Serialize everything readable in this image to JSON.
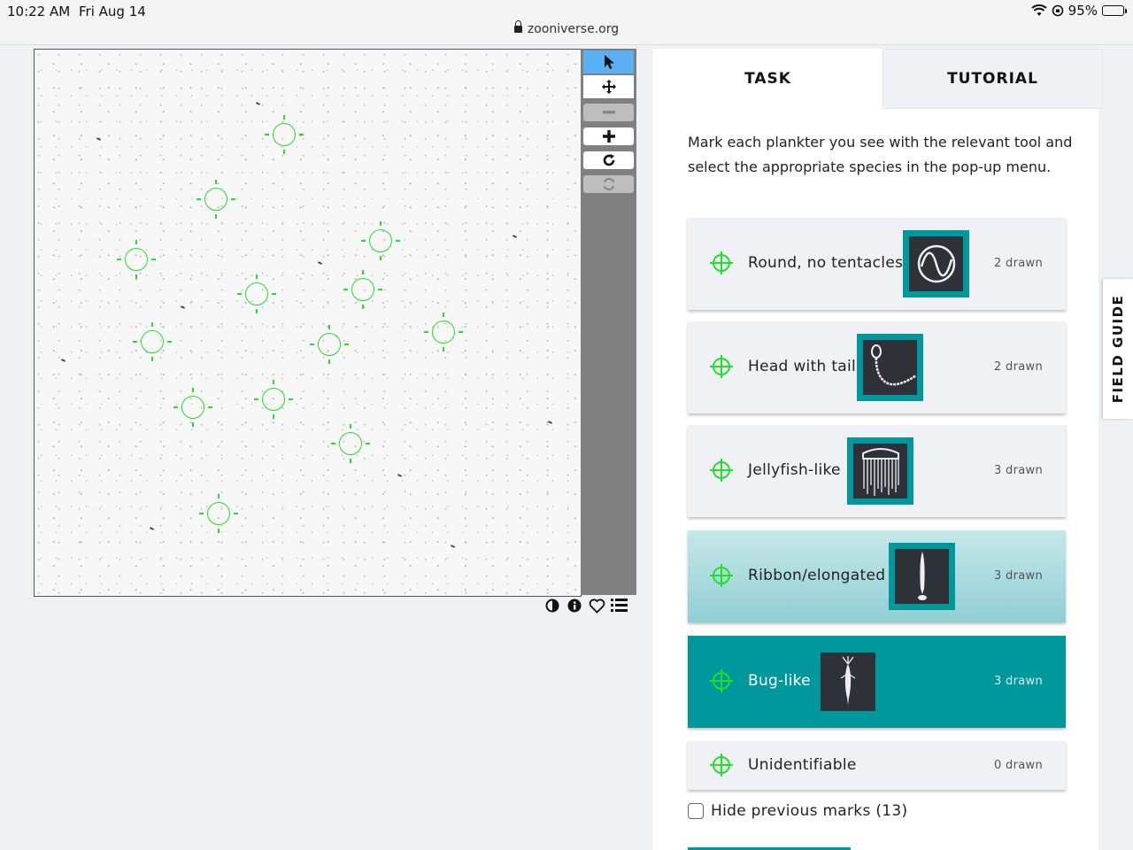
{
  "status_bar": {
    "time": "10:22 AM",
    "date": "Fri Aug 14",
    "url": "zooniverse.org",
    "battery": "95%",
    "battery_level": 0.95
  },
  "toolbar": {
    "tools": [
      {
        "name": "pointer",
        "glyph": "➤",
        "active": true
      },
      {
        "name": "pan",
        "glyph": "✥",
        "active": false
      },
      {
        "name": "zoom-out",
        "glyph": "−",
        "disabled": true
      },
      {
        "name": "zoom-in",
        "glyph": "+"
      },
      {
        "name": "rotate",
        "glyph": "↻"
      },
      {
        "name": "reset",
        "glyph": "⟲",
        "disabled": true
      }
    ],
    "below_icons": [
      "contrast-icon",
      "info-icon",
      "heart-icon",
      "list-icon"
    ]
  },
  "subject": {
    "mark_count": 13
  },
  "tabs": {
    "task": "TASK",
    "tutorial": "TUTORIAL"
  },
  "task": {
    "instructions": "Mark each plankter you see with the relevant tool and select the appropriate species in the pop-up menu.",
    "tools": [
      {
        "label": "Round, no tentacles",
        "count": "2 drawn",
        "icon": "round-plankter-icon"
      },
      {
        "label": "Head with tail",
        "count": "2 drawn",
        "icon": "head-tail-plankter-icon"
      },
      {
        "label": "Jellyfish-like",
        "count": "3 drawn",
        "icon": "jellyfish-plankter-icon"
      },
      {
        "label": "Ribbon/elongated",
        "count": "3 drawn",
        "icon": "ribbon-plankter-icon"
      },
      {
        "label": "Bug-like",
        "count": "3 drawn",
        "icon": "bug-plankter-icon"
      },
      {
        "label": "Unidentifiable",
        "count": "0 drawn",
        "icon": null
      }
    ],
    "hide_previous": "Hide previous marks (13)"
  },
  "field_guide": "FIELD GUIDE",
  "colors": {
    "teal": "#00979d",
    "mark_green": "#22e02a",
    "active_tool": "#5ab0f5"
  }
}
